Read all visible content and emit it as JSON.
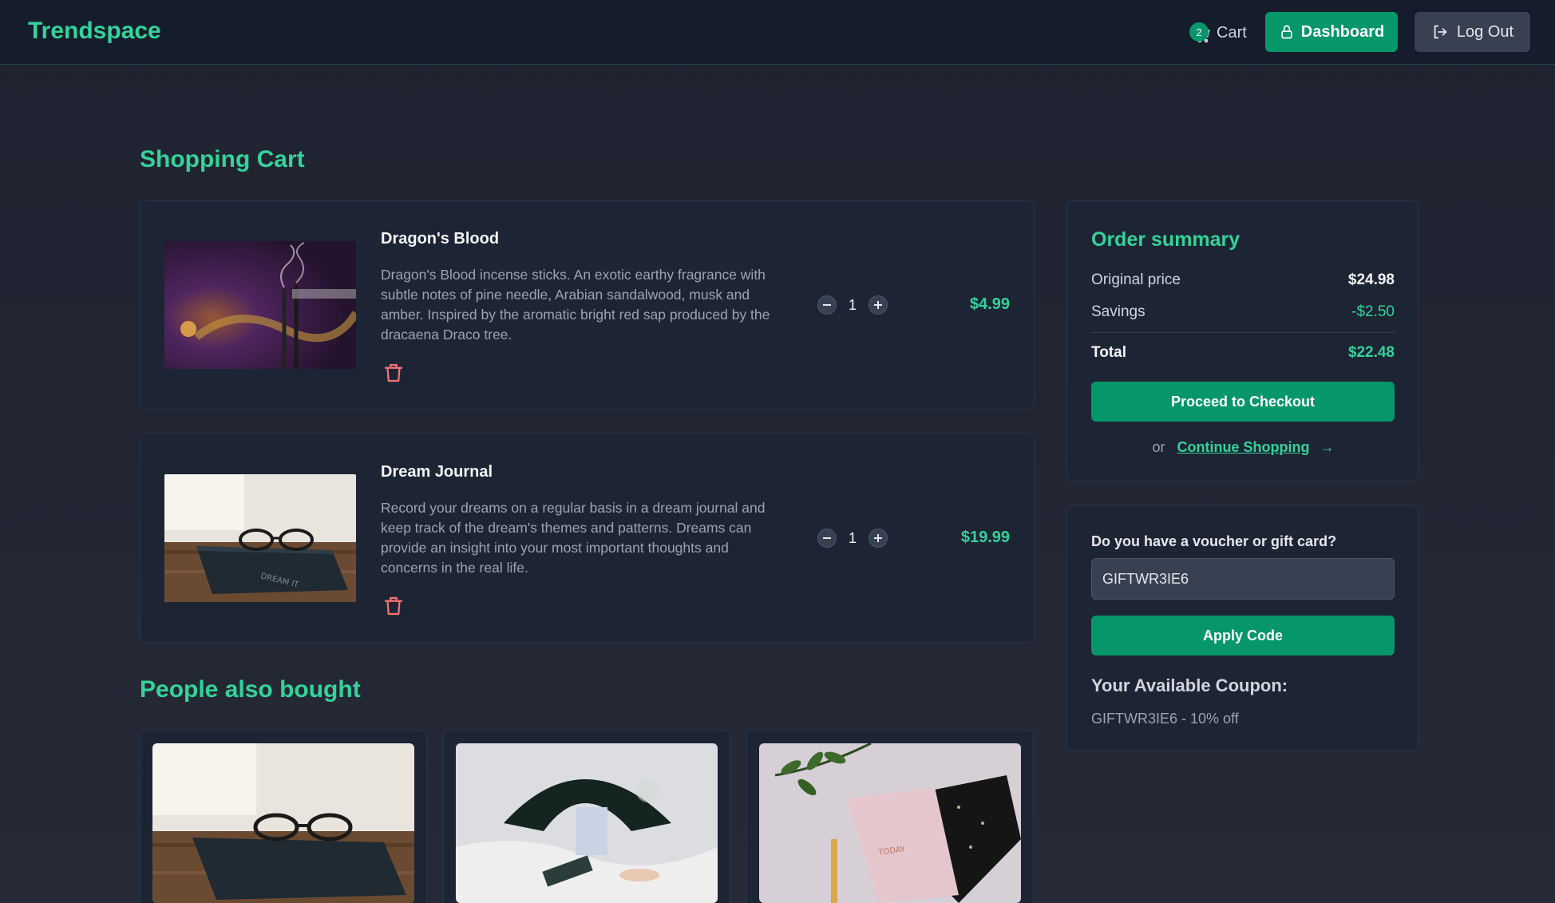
{
  "header": {
    "logo": "Trendspace",
    "cart_label": "Cart",
    "cart_count": "2",
    "dashboard_label": "Dashboard",
    "logout_label": "Log Out"
  },
  "cart": {
    "title": "Shopping Cart",
    "items": [
      {
        "name": "Dragon's Blood",
        "description": "Dragon's Blood incense sticks. An exotic earthy fragrance with subtle notes of pine needle, Arabian sandalwood, musk and amber. Inspired by the aromatic bright red sap produced by the dracaena Draco tree.",
        "quantity": "1",
        "price": "$4.99"
      },
      {
        "name": "Dream Journal",
        "description": "Record your dreams on a regular basis in a dream journal and keep track of the dream's themes and patterns. Dreams can provide an insight into your most important thoughts and concerns in the real life.",
        "quantity": "1",
        "price": "$19.99"
      }
    ]
  },
  "summary": {
    "title": "Order summary",
    "original_label": "Original price",
    "original_value": "$24.98",
    "savings_label": "Savings",
    "savings_value": "-$2.50",
    "total_label": "Total",
    "total_value": "$22.48",
    "checkout_label": "Proceed to Checkout",
    "or_text": "or",
    "continue_label": "Continue Shopping",
    "arrow": "→"
  },
  "voucher": {
    "label": "Do you have a voucher or gift card?",
    "input_value": "GIFTWR3IE6",
    "apply_label": "Apply Code",
    "coupon_title": "Your Available Coupon:",
    "coupon_text": "GIFTWR3IE6 - 10% off"
  },
  "recommendations": {
    "title": "People also bought"
  },
  "colors": {
    "accent": "#34d399",
    "button": "#059669",
    "background": "#1f2230",
    "card": "#1d2535",
    "danger": "#f87171"
  }
}
